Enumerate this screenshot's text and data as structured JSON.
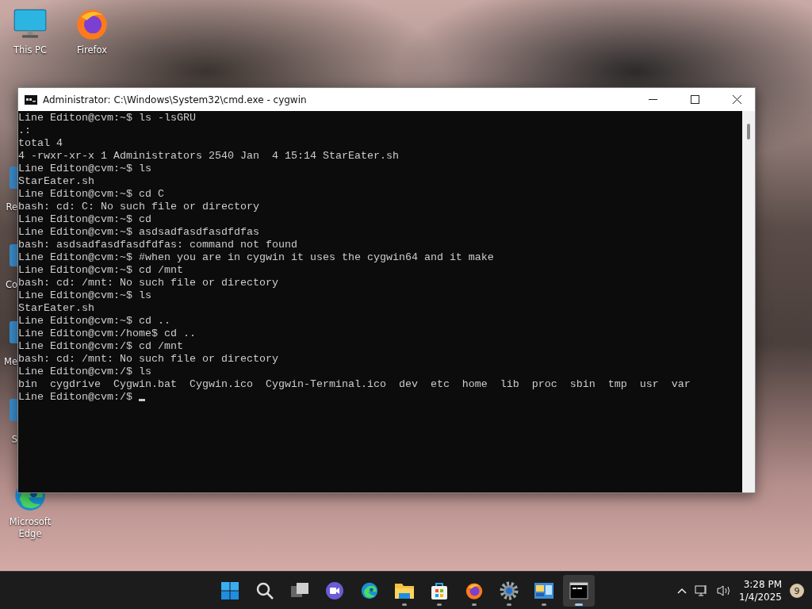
{
  "desktop_icons": [
    {
      "label": "This PC",
      "kind": "pc"
    },
    {
      "label": "Firefox",
      "kind": "firefox"
    },
    {
      "label": "Microsoft Edge",
      "kind": "edge"
    }
  ],
  "hidden_icon_labels": [
    "Re",
    "Co",
    "Me",
    "S"
  ],
  "window": {
    "title": "Administrator: C:\\Windows\\System32\\cmd.exe - cygwin",
    "lines": [
      "Line Editon@cvm:~$ ls -lsGRU",
      ".:",
      "total 4",
      "4 -rwxr-xr-x 1 Administrators 2540 Jan  4 15:14 StarEater.sh",
      "Line Editon@cvm:~$ ls",
      "StarEater.sh",
      "Line Editon@cvm:~$ cd C",
      "bash: cd: C: No such file or directory",
      "Line Editon@cvm:~$ cd",
      "Line Editon@cvm:~$ asdsadfasdfasdfdfas",
      "bash: asdsadfasdfasdfdfas: command not found",
      "Line Editon@cvm:~$ #when you are in cygwin it uses the cygwin64 and it make",
      "Line Editon@cvm:~$ cd /mnt",
      "bash: cd: /mnt: No such file or directory",
      "Line Editon@cvm:~$ ls",
      "StarEater.sh",
      "Line Editon@cvm:~$ cd ..",
      "Line Editon@cvm:/home$ cd ..",
      "Line Editon@cvm:/$ cd /mnt",
      "bash: cd: /mnt: No such file or directory",
      "Line Editon@cvm:/$ ls",
      "bin  cygdrive  Cygwin.bat  Cygwin.ico  Cygwin-Terminal.ico  dev  etc  home  lib  proc  sbin  tmp  usr  var",
      "Line Editon@cvm:/$ "
    ],
    "cursor_visible": true
  },
  "taskbar": [
    {
      "kind": "start",
      "running": false,
      "selected": false
    },
    {
      "kind": "search",
      "running": false,
      "selected": false
    },
    {
      "kind": "taskview",
      "running": false,
      "selected": false
    },
    {
      "kind": "meet",
      "running": false,
      "selected": false
    },
    {
      "kind": "edge",
      "running": false,
      "selected": false
    },
    {
      "kind": "folder",
      "running": true,
      "selected": false
    },
    {
      "kind": "store",
      "running": true,
      "selected": false
    },
    {
      "kind": "firefox",
      "running": true,
      "selected": false
    },
    {
      "kind": "gear",
      "running": true,
      "selected": false
    },
    {
      "kind": "panel",
      "running": true,
      "selected": false
    },
    {
      "kind": "terminal",
      "running": true,
      "selected": true
    }
  ],
  "tray": {
    "time": "3:28 PM",
    "date": "1/4/2025",
    "notifications": "9"
  }
}
